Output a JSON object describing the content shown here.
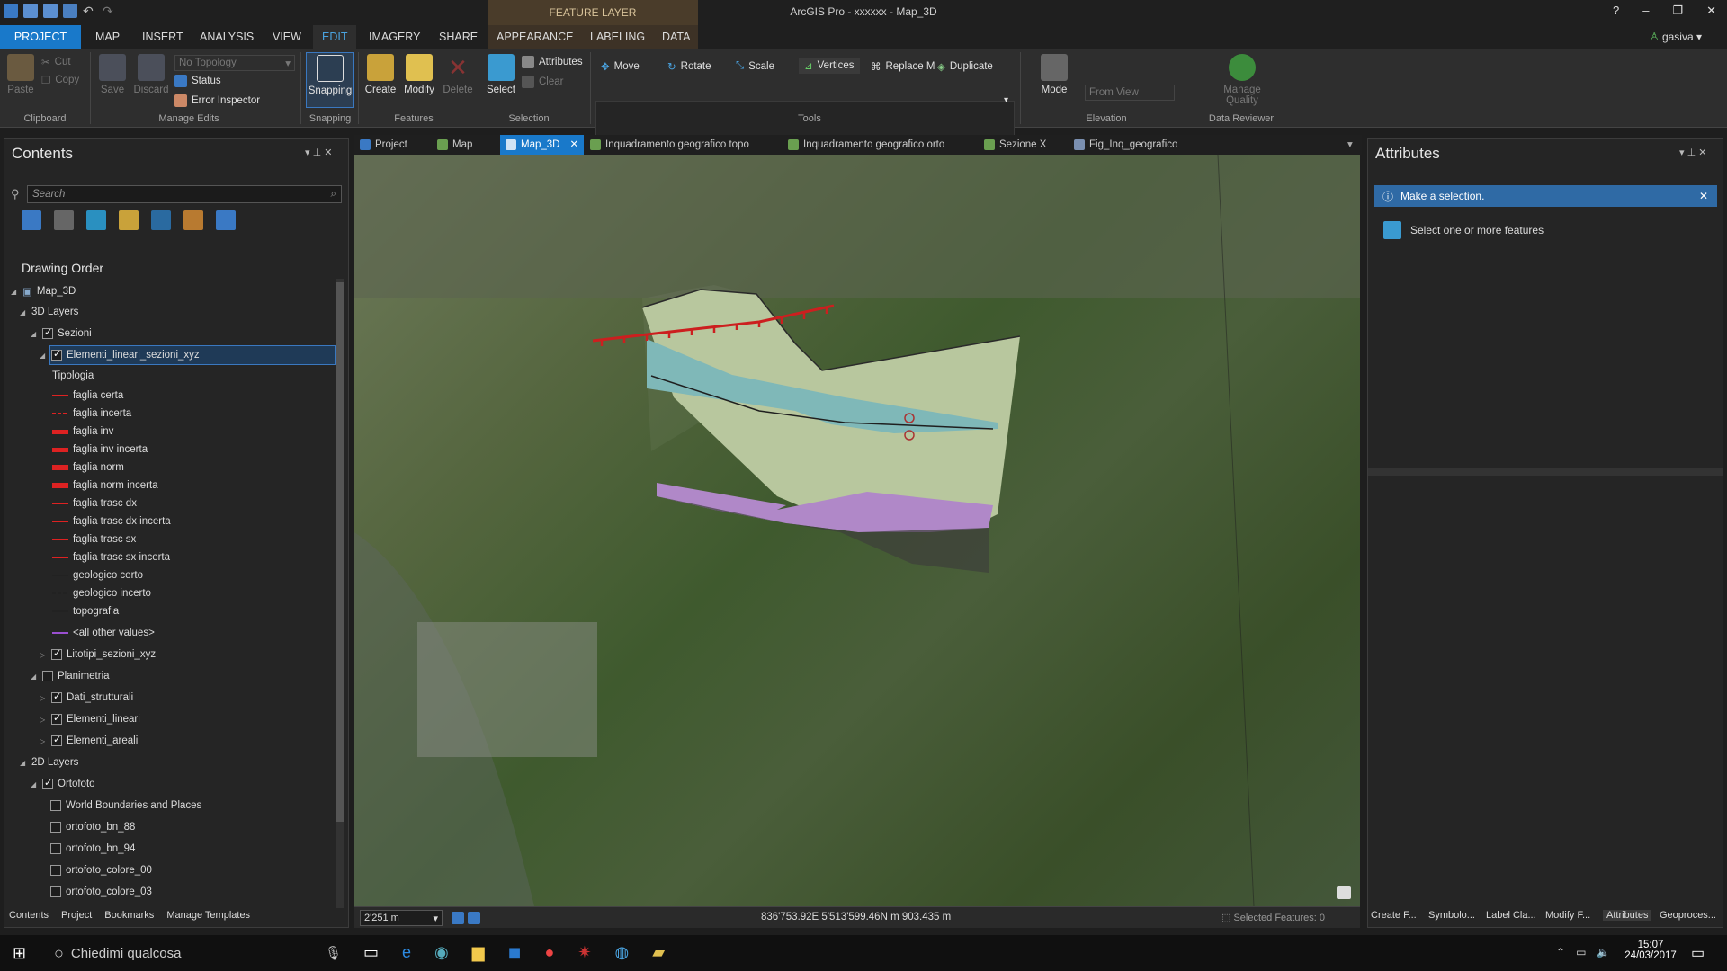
{
  "app": {
    "title": "ArcGIS Pro - xxxxxx - Map_3D",
    "context_header": "FEATURE LAYER",
    "user": "gasiva"
  },
  "window_controls": [
    "?",
    "–",
    "❐",
    "✕"
  ],
  "ribbon_tabs": [
    "PROJECT",
    "MAP",
    "INSERT",
    "ANALYSIS",
    "VIEW",
    "EDIT",
    "IMAGERY",
    "SHARE",
    "APPEARANCE",
    "LABELING",
    "DATA"
  ],
  "ribbon": {
    "clipboard": {
      "paste": "Paste",
      "cut": "Cut",
      "copy": "Copy",
      "group": "Clipboard"
    },
    "manage_edits": {
      "save": "Save",
      "discard": "Discard",
      "topology": "No Topology",
      "status": "Status",
      "error_inspector": "Error Inspector",
      "group": "Manage Edits"
    },
    "snapping": {
      "snapping": "Snapping",
      "group": "Snapping"
    },
    "features": {
      "create": "Create",
      "modify": "Modify",
      "delete": "Delete",
      "group": "Features"
    },
    "selection": {
      "select": "Select",
      "attributes": "Attributes",
      "clear": "Clear",
      "group": "Selection"
    },
    "tools": {
      "move": "Move",
      "rotate": "Rotate",
      "scale": "Scale",
      "vertices": "Vertices",
      "replace": "Replace M",
      "duplicate": "Duplicate",
      "group": "Tools"
    },
    "elevation": {
      "mode": "Mode",
      "from_view": "From View",
      "group": "Elevation"
    },
    "data_reviewer": {
      "manage_quality": "Manage Quality",
      "group": "Data Reviewer"
    }
  },
  "contents": {
    "title": "Contents",
    "search_placeholder": "Search",
    "drawing_order": "Drawing Order",
    "nodes": [
      {
        "label": "Map_3D"
      },
      {
        "label": "3D Layers"
      },
      {
        "label": "Sezioni"
      },
      {
        "label": "Elementi_lineari_sezioni_xyz"
      },
      {
        "label": "Tipologia"
      },
      {
        "label": "faglia certa"
      },
      {
        "label": "faglia incerta"
      },
      {
        "label": "faglia inv"
      },
      {
        "label": "faglia inv incerta"
      },
      {
        "label": "faglia norm"
      },
      {
        "label": "faglia norm incerta"
      },
      {
        "label": "faglia trasc dx"
      },
      {
        "label": "faglia trasc dx incerta"
      },
      {
        "label": "faglia trasc sx"
      },
      {
        "label": "faglia trasc sx incerta"
      },
      {
        "label": "geologico certo"
      },
      {
        "label": "geologico incerto"
      },
      {
        "label": "topografia"
      },
      {
        "label": "<all other values>"
      },
      {
        "label": "Litotipi_sezioni_xyz"
      },
      {
        "label": "Planimetria"
      },
      {
        "label": "Dati_strutturali"
      },
      {
        "label": "Elementi_lineari"
      },
      {
        "label": "Elementi_areali"
      },
      {
        "label": "2D Layers"
      },
      {
        "label": "Ortofoto"
      },
      {
        "label": "World Boundaries and Places"
      },
      {
        "label": "ortofoto_bn_88"
      },
      {
        "label": "ortofoto_bn_94"
      },
      {
        "label": "ortofoto_colore_00"
      },
      {
        "label": "ortofoto_colore_03"
      }
    ],
    "bottom_tabs": [
      "Contents",
      "Project",
      "Bookmarks",
      "Manage Templates"
    ]
  },
  "doc_tabs": [
    "Project",
    "Map",
    "Map_3D",
    "Inquadramento geografico topo",
    "Inquadramento geografico orto",
    "Sezione X",
    "Fig_Inq_geografico"
  ],
  "status": {
    "scale": "2'251 m",
    "coords": "836'753.92E 5'513'599.46N m  903.435 m",
    "selected": "Selected Features: 0"
  },
  "attributes": {
    "title": "Attributes",
    "info": "Make a selection.",
    "hint": "Select one or more features"
  },
  "right_bottom_tabs": [
    "Create F...",
    "Symbolo...",
    "Label Cla...",
    "Modify F...",
    "Attributes",
    "Geoproces..."
  ],
  "taskbar": {
    "search": "Chiedimi qualcosa",
    "time": "15:07",
    "date": "24/03/2017"
  },
  "colors": {
    "accent": "#1979ca",
    "fault": "#d22222",
    "section_green": "#b9c8a0",
    "section_teal": "#7fb8b8",
    "section_purple": "#b088c8"
  }
}
